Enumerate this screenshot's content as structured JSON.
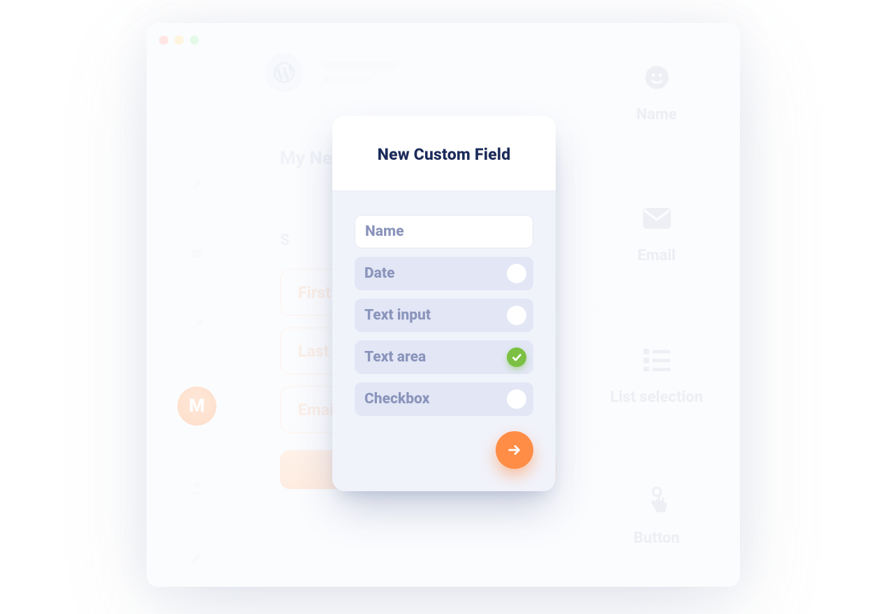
{
  "background": {
    "page_title": "My New",
    "section_label": "S",
    "fields": [
      "First",
      "Last",
      "Emai"
    ],
    "right_panel": [
      {
        "icon": "smile",
        "label": "Name"
      },
      {
        "icon": "mail",
        "label": "Email"
      },
      {
        "icon": "list",
        "label": "List selection"
      },
      {
        "icon": "tap",
        "label": "Button"
      }
    ],
    "sidebar_badge": "M"
  },
  "modal": {
    "title": "New Custom Field",
    "name_input_label": "Name",
    "options": [
      {
        "label": "Date",
        "selected": false
      },
      {
        "label": "Text input",
        "selected": false
      },
      {
        "label": "Text area",
        "selected": true
      },
      {
        "label": "Checkbox",
        "selected": false
      }
    ]
  },
  "colors": {
    "accent": "#ff8d45",
    "success": "#7bc043",
    "title": "#1a2b5c",
    "muted": "#8a94bb"
  }
}
